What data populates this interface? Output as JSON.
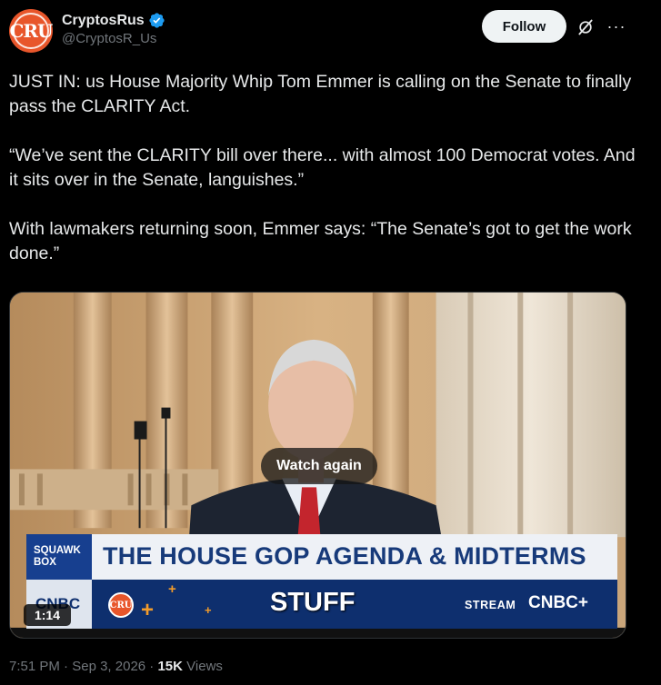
{
  "author": {
    "display_name": "CryptosRus",
    "handle": "@CryptosR_Us",
    "avatar_text": "CRU",
    "verified_icon": "verified-badge-icon",
    "brand_color": "#e8562b"
  },
  "actions": {
    "follow_label": "Follow",
    "grok_icon": "grok-icon",
    "more_icon": "more-icon",
    "more_glyph": "···"
  },
  "tweet": {
    "paragraphs": [
      "JUST IN: us House Majority Whip Tom Emmer is calling on the Senate to finally pass the CLARITY Act.",
      "“We’ve sent the CLARITY bill over there... with almost 100 Democrat votes. And it sits over in the Senate, languishes.”",
      "With lawmakers returning soon, Emmer says: “The Senate’s got to get the work done.”"
    ]
  },
  "media": {
    "overlay_label": "Watch again",
    "duration": "1:14",
    "chyron": {
      "show_tag": "SQUAWK BOX",
      "headline": "THE HOUSE GOP AGENDA & MIDTERMS",
      "subhead": "STUFF",
      "network_logo": "CNBC",
      "mini_logo_text": "CRU",
      "stream_label": "STREAM",
      "stream_brand": "CNBC+"
    }
  },
  "footer": {
    "time": "7:51 PM",
    "date": "Sep 3, 2026",
    "separator": "·",
    "views_count": "15K",
    "views_label": "Views"
  },
  "colors": {
    "background": "#000000",
    "text": "#e7e9ea",
    "muted": "#71767b",
    "verified": "#1d9bf0"
  }
}
